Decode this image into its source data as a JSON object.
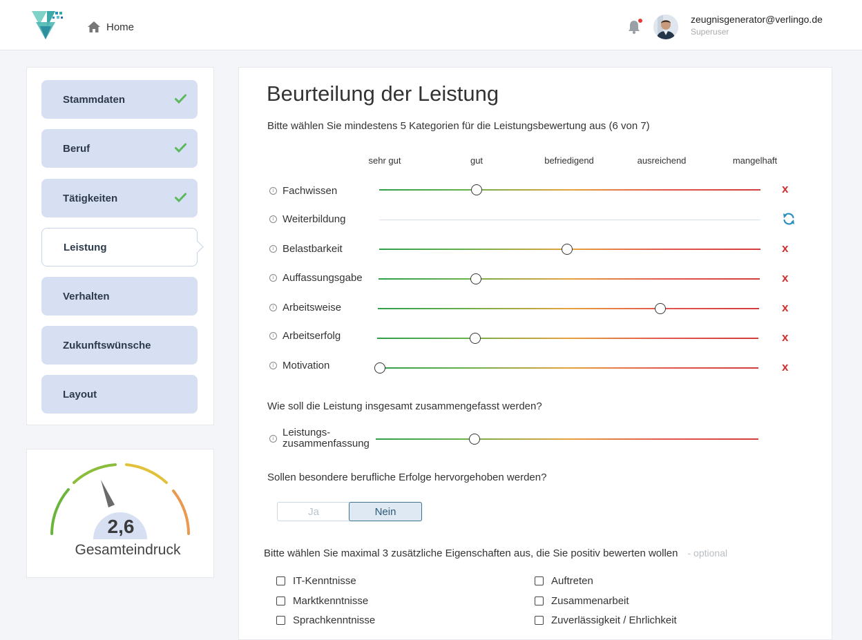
{
  "header": {
    "home_label": "Home",
    "user_email": "zeugnisgenerator@verlingo.de",
    "user_role": "Superuser"
  },
  "sidebar": {
    "steps": [
      {
        "label": "Stammdaten",
        "done": true
      },
      {
        "label": "Beruf",
        "done": true
      },
      {
        "label": "Tätigkeiten",
        "done": true
      },
      {
        "label": "Leistung",
        "active": true
      },
      {
        "label": "Verhalten"
      },
      {
        "label": "Zukunftswünsche"
      },
      {
        "label": "Layout"
      }
    ]
  },
  "gauge": {
    "value": "2,6",
    "label": "Gesamteindruck"
  },
  "main": {
    "title": "Beurteilung der Leistung",
    "intro": "Bitte wählen Sie mindestens 5 Kategorien für die Leistungsbewertung aus (6 von 7)",
    "scale": [
      "sehr gut",
      "gut",
      "befriedigend",
      "ausreichend",
      "mangelhaft"
    ],
    "ratings": [
      {
        "label": "Fachwissen",
        "value": 0.256
      },
      {
        "label": "Weiterbildung",
        "value": null
      },
      {
        "label": "Belastbarkeit",
        "value": 0.492
      },
      {
        "label": "Auffassungsgabe",
        "value": 0.256
      },
      {
        "label": "Arbeitsweise",
        "value": 0.741
      },
      {
        "label": "Arbeitserfolg",
        "value": 0.258
      },
      {
        "label": "Motivation",
        "value": 0.0
      }
    ],
    "summary_question": "Wie soll die Leistung insgesamt zusammengefasst werden?",
    "summary_label_1": "Leistungs-",
    "summary_label_2": "zusammenfassung",
    "summary_value": 0.259,
    "success_question": "Sollen besondere berufliche Erfolge hervorgehoben werden?",
    "toggle_yes": "Ja",
    "toggle_no": "Nein",
    "traits_question": "Bitte wählen Sie maximal 3 zusätzliche Eigenschaften aus, die Sie positiv bewerten wollen",
    "traits_optional": "- optional",
    "traits_left": [
      "IT-Kenntnisse",
      "Marktkenntnisse",
      "Sprachkenntnisse"
    ],
    "traits_right": [
      "Auftreten",
      "Zusammenarbeit",
      "Zuverlässigkeit / Ehrlichkeit"
    ]
  },
  "colors": {
    "accent": "#2a8fbd",
    "step_bg": "#d6e0f2",
    "remove": "#d32f2f",
    "check": "#5cb85c"
  }
}
